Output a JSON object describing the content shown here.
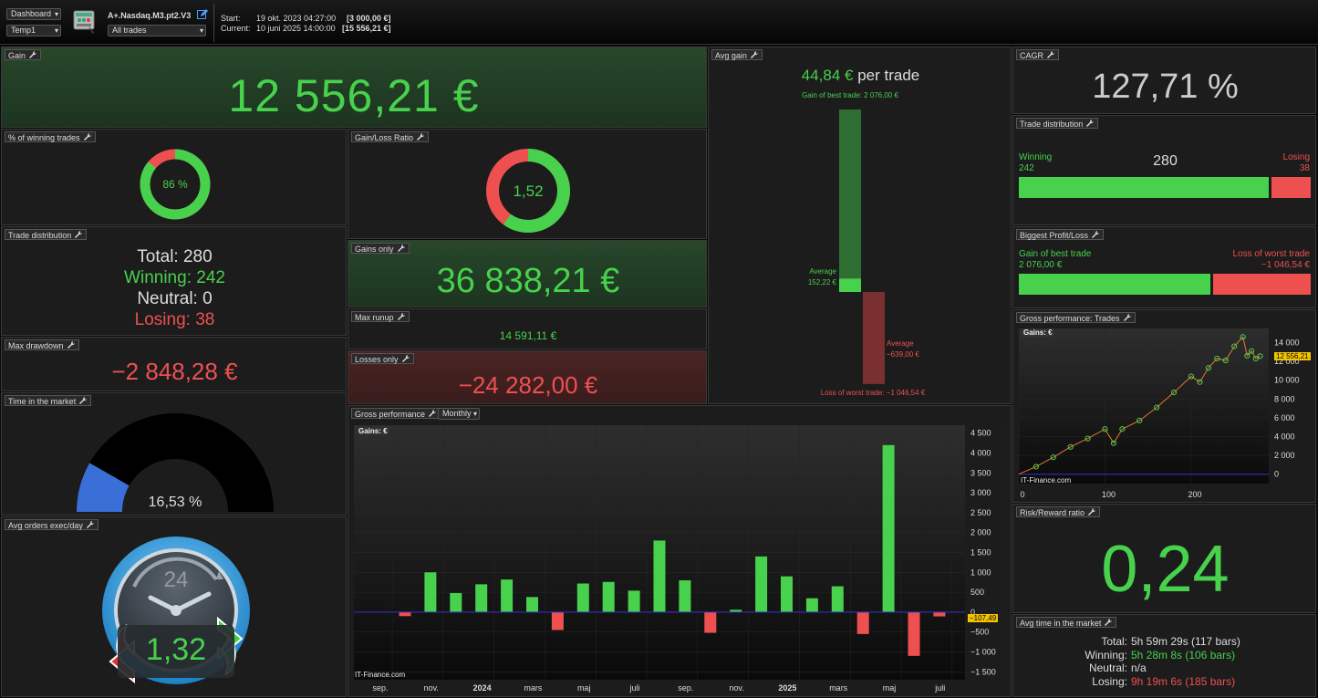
{
  "toolbar": {
    "dashboard_select": "Dashboard",
    "template_select": "Temp1",
    "strategy_name": "A+.Nasdaq.M3.pt2.V3",
    "trades_filter": "All trades",
    "start_label": "Start:",
    "start_date": "19 okt. 2023 04:27:00",
    "start_capital": "[3 000,00 €]",
    "current_label": "Current:",
    "current_date": "10 juni 2025 14:00:00",
    "current_capital": "[15 556,21 €]"
  },
  "gain": {
    "title": "Gain",
    "value": "12 556,21 €"
  },
  "winning_pct": {
    "title": "% of winning trades",
    "value": "86 %",
    "fraction": 0.86
  },
  "gl_ratio": {
    "title": "Gain/Loss Ratio",
    "value": "1,52",
    "fraction": 0.6
  },
  "trade_dist_text": {
    "title": "Trade distribution",
    "total": "Total: 280",
    "winning": "Winning: 242",
    "neutral": "Neutral: 0",
    "losing": "Losing: 38"
  },
  "gains_only": {
    "title": "Gains only",
    "value": "36 838,21 €"
  },
  "max_runup": {
    "title": "Max runup",
    "value": "14 591,11 €"
  },
  "losses_only": {
    "title": "Losses only",
    "value": "−24 282,00 €"
  },
  "max_drawdown": {
    "title": "Max drawdown",
    "value": "−2 848,28 €"
  },
  "time_in_market": {
    "title": "Time in the market",
    "value": "16,53 %",
    "fraction": 0.1653
  },
  "avg_orders": {
    "title": "Avg orders exec/day",
    "value": "1,32",
    "clock_label": "24"
  },
  "avg_gain": {
    "title": "Avg gain",
    "value": "44,84 €",
    "suffix": "per trade",
    "best_label": "Gain of best trade: 2 076,00 €",
    "avg_gain_label": "Average",
    "avg_gain_value": "152,22 €",
    "avg_loss_label": "Average",
    "avg_loss_value": "−639,00 €",
    "worst_label": "Loss of worst trade: −1 046,54 €",
    "best": 2076.0,
    "avg_win": 152.22,
    "avg_loss": -639.0,
    "worst": -1046.54
  },
  "cagr": {
    "title": "CAGR",
    "value": "127,71 %"
  },
  "trade_dist_bar": {
    "title": "Trade distribution",
    "winning_label": "Winning",
    "winning_count": "242",
    "total": "280",
    "losing_label": "Losing",
    "losing_count": "38",
    "winning": 242,
    "losing": 38
  },
  "biggest_pl": {
    "title": "Biggest Profit/Loss",
    "best_label": "Gain of best trade",
    "best_value": "2 076,00 €",
    "worst_label": "Loss of worst trade",
    "worst_value": "−1 046,54 €",
    "best": 2076.0,
    "worst": 1046.54
  },
  "gross_trades": {
    "title": "Gross performance: Trades",
    "legend": "Gains: €",
    "watermark": "IT-Finance.com",
    "last_value_label": "12 556,21"
  },
  "risk_reward": {
    "title": "Risk/Reward ratio",
    "value": "0,24"
  },
  "avg_time": {
    "title": "Avg time in the market",
    "rows": [
      {
        "label": "Total:",
        "value": "5h 59m 29s (117 bars)"
      },
      {
        "label": "Winning:",
        "value": "5h 28m 8s (106 bars)"
      },
      {
        "label": "Neutral:",
        "value": "n/a"
      },
      {
        "label": "Losing:",
        "value": "9h 19m 6s (185 bars)"
      }
    ]
  },
  "gross_monthly": {
    "title": "Gross performance",
    "period_select": "Monthly",
    "legend": "Gains: €",
    "watermark": "IT-Finance.com",
    "last_value_label": "−107,49"
  },
  "chart_data": [
    {
      "type": "bar",
      "title": "Gross performance",
      "legend": "Gains: €",
      "x_labels": [
        "sep.",
        "nov.",
        "2024",
        "mars",
        "maj",
        "juli",
        "sep.",
        "nov.",
        "2025",
        "mars",
        "maj",
        "juli"
      ],
      "categories": [
        "2023-10",
        "2023-11",
        "2023-12",
        "2024-01",
        "2024-02",
        "2024-03",
        "2024-04",
        "2024-05",
        "2024-06",
        "2024-07",
        "2024-08",
        "2024-09",
        "2024-10",
        "2024-11",
        "2024-12",
        "2025-01",
        "2025-02",
        "2025-03",
        "2025-04",
        "2025-05",
        "2025-06"
      ],
      "values": [
        -100,
        1000,
        480,
        700,
        820,
        380,
        -450,
        720,
        760,
        540,
        1800,
        800,
        -520,
        60,
        1400,
        900,
        350,
        650,
        -550,
        4200,
        -1100,
        -107.49
      ],
      "ylim": [
        -1700,
        4700
      ],
      "y_ticks": [
        -1500,
        -1000,
        -500,
        0,
        500,
        1000,
        1500,
        2000,
        2500,
        3000,
        3500,
        4000,
        4500
      ],
      "y_tick_labels": [
        "−1 500",
        "−1 000",
        "−500",
        "0",
        "500",
        "1 000",
        "1 500",
        "2 000",
        "2 500",
        "3 000",
        "3 500",
        "4 000",
        "4 500"
      ]
    },
    {
      "type": "line",
      "title": "Gross performance: Trades",
      "legend": "Gains: €",
      "xlim": [
        0,
        290
      ],
      "ylim": [
        -1000,
        15500
      ],
      "x_ticks": [
        0,
        100,
        200
      ],
      "y_ticks": [
        0,
        2000,
        4000,
        6000,
        8000,
        10000,
        12000,
        14000
      ],
      "y_tick_labels": [
        "0",
        "2 000",
        "4 000",
        "6 000",
        "8 000",
        "10 000",
        "12 000",
        "14 000"
      ],
      "x": [
        0,
        20,
        40,
        60,
        80,
        100,
        110,
        120,
        140,
        160,
        180,
        200,
        210,
        220,
        230,
        240,
        250,
        260,
        265,
        270,
        275,
        280
      ],
      "y": [
        0,
        800,
        1800,
        2900,
        3800,
        4800,
        3300,
        4800,
        5700,
        7100,
        8700,
        10400,
        9800,
        11300,
        12300,
        12100,
        13600,
        14600,
        12600,
        13100,
        12300,
        12556.21
      ]
    }
  ]
}
